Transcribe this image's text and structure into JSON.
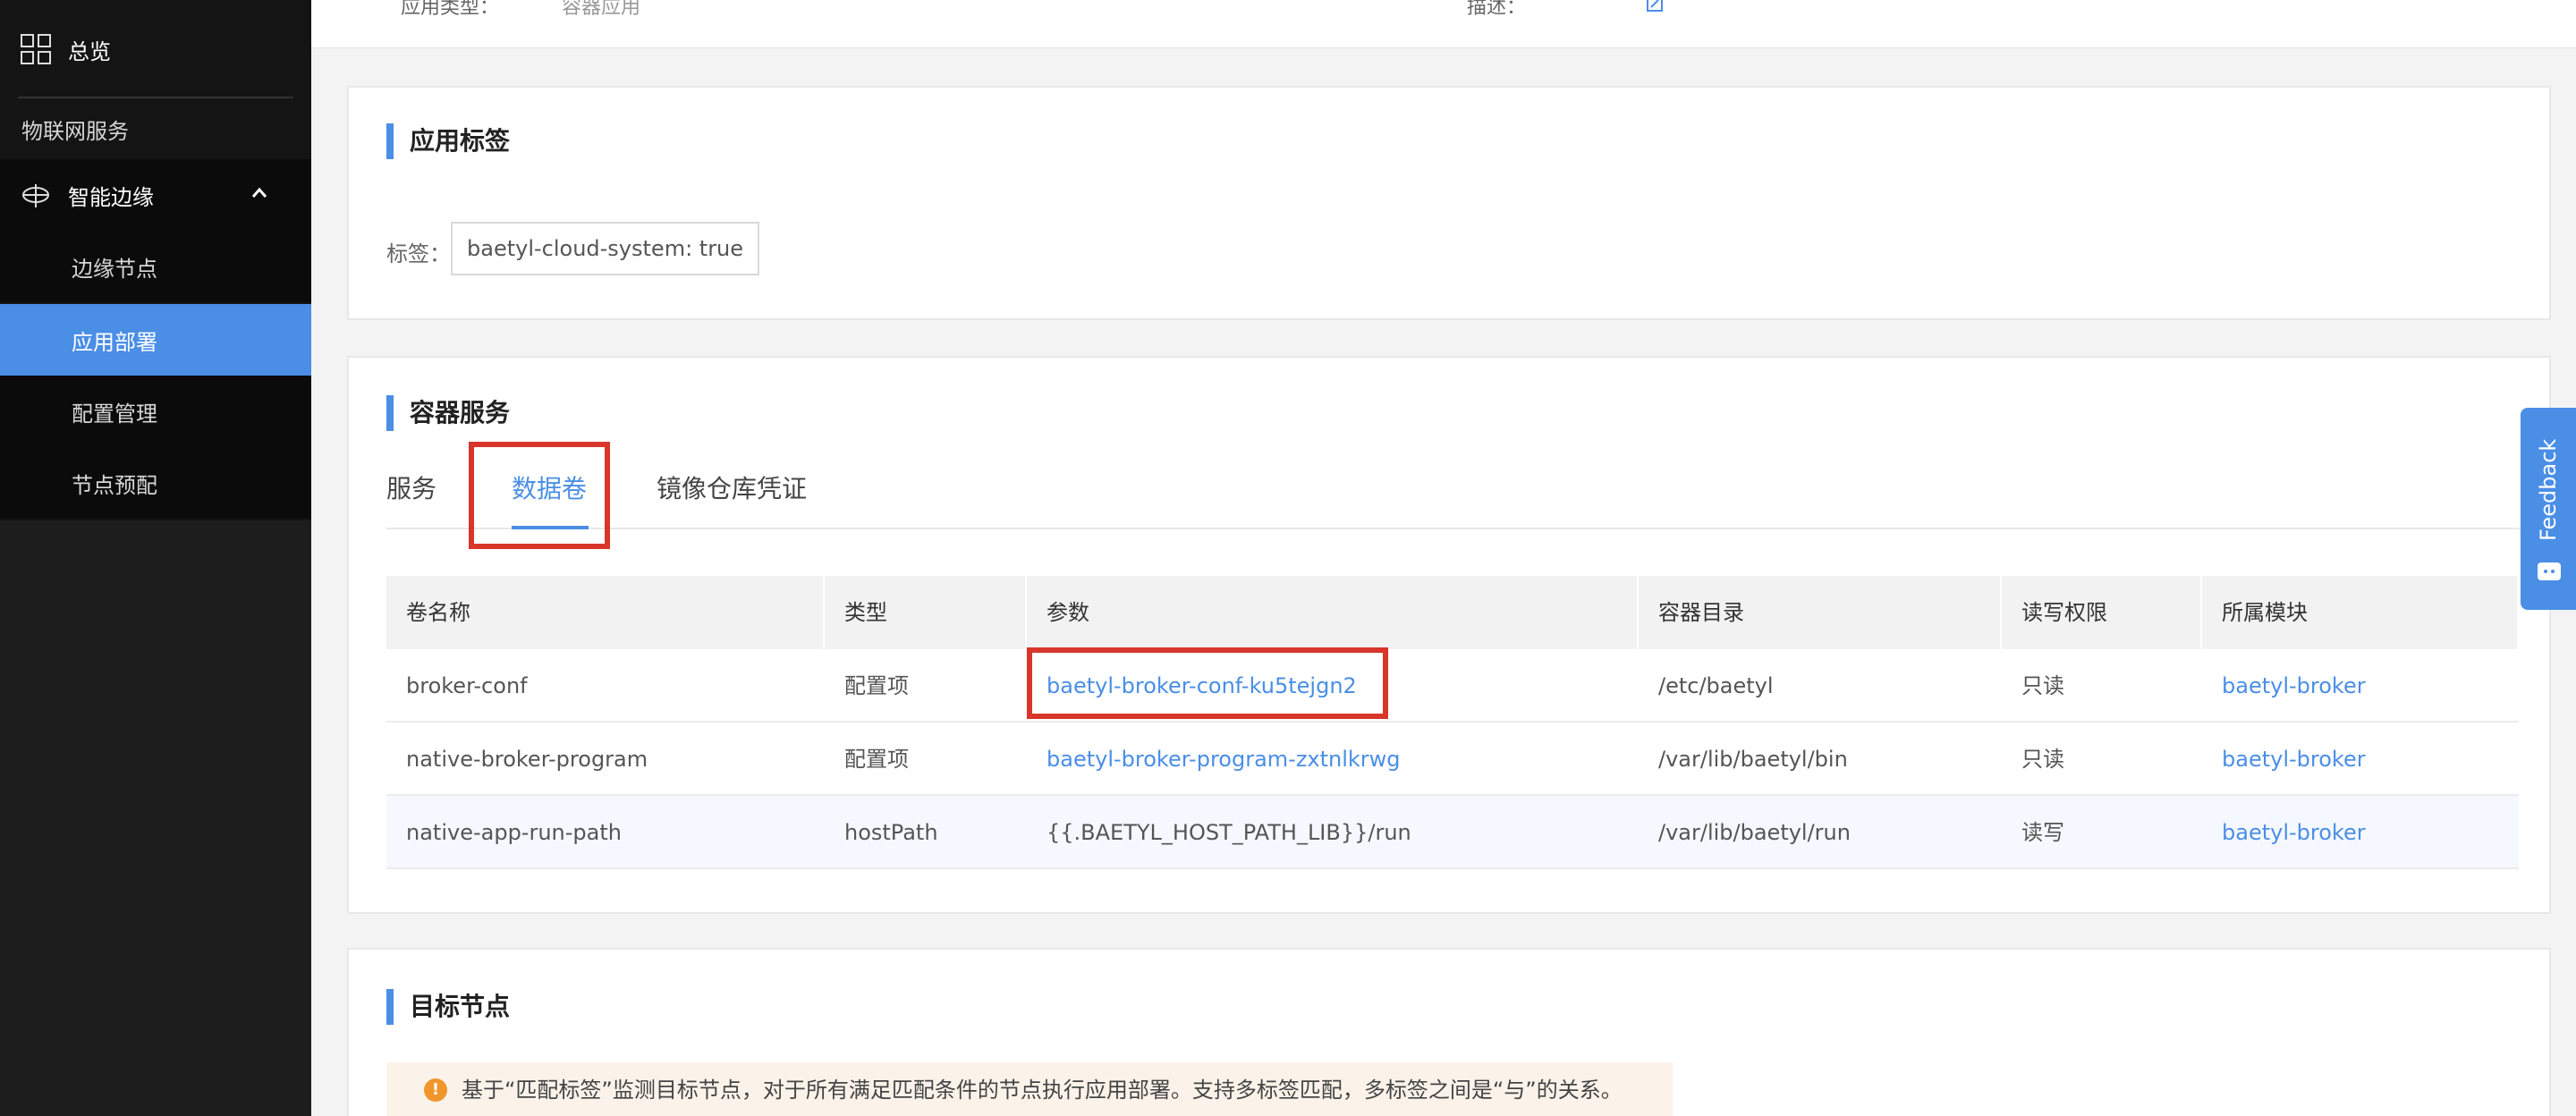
{
  "sidebar": {
    "overview": "总览",
    "iot_services": "物联网服务",
    "edge": "智能边缘",
    "items": [
      {
        "label": "边缘节点"
      },
      {
        "label": "应用部署"
      },
      {
        "label": "配置管理"
      },
      {
        "label": "节点预配"
      }
    ],
    "active_item": "应用部署",
    "active_color": "#4a8ee6"
  },
  "top_card": {
    "app_type_key": "应用类型：",
    "app_type_value": "容器应用",
    "desc_key": "描述："
  },
  "app_tags": {
    "title": "应用标签",
    "label": "标签：",
    "tag": "baetyl-cloud-system: true"
  },
  "container_services": {
    "title": "容器服务",
    "tabs": [
      "服务",
      "数据卷",
      "镜像仓库凭证"
    ],
    "active_tab": "数据卷",
    "table": {
      "headers": [
        "卷名称",
        "类型",
        "参数",
        "容器目录",
        "读写权限",
        "所属模块"
      ],
      "rows": [
        [
          "broker-conf",
          "配置项",
          "baetyl-broker-conf-ku5tejgn2",
          "/etc/baetyl",
          "只读",
          "baetyl-broker"
        ],
        [
          "native-broker-program",
          "配置项",
          "baetyl-broker-program-zxtnlkrwg",
          "/var/lib/baetyl/bin",
          "只读",
          "baetyl-broker"
        ],
        [
          "native-app-run-path",
          "hostPath",
          "{{.BAETYL_HOST_PATH_LIB}}/run",
          "/var/lib/baetyl/run",
          "读写",
          "baetyl-broker"
        ]
      ]
    }
  },
  "target_nodes": {
    "title": "目标节点",
    "notice": "基于“匹配标签”监测目标节点，对于所有满足匹配条件的节点执行应用部署。支持多标签匹配，多标签之间是“与”的关系。"
  },
  "feedback": {
    "label": "Feedback"
  },
  "colors": {
    "accent": "#4a8ee6",
    "highlight_box": "#d8362a",
    "sidebar_bg": "#1a1a1a",
    "warning": "#f0962c"
  }
}
